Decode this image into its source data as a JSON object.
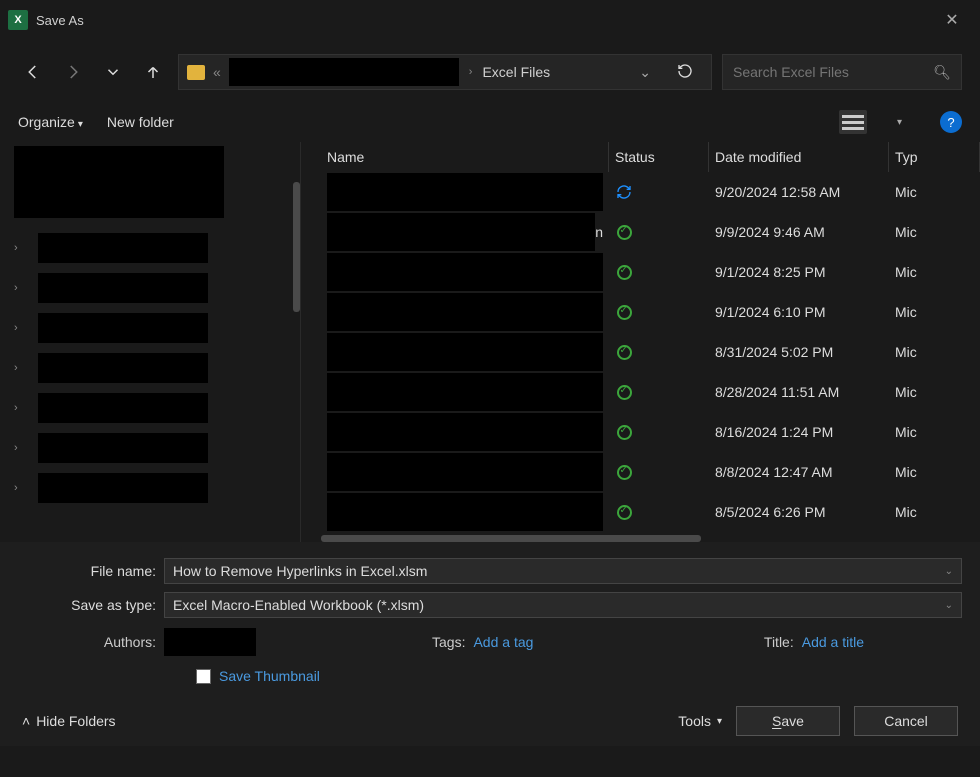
{
  "title": "Save As",
  "breadcrumb": {
    "segment": "Excel Files"
  },
  "search": {
    "placeholder": "Search Excel Files"
  },
  "toolbar": {
    "organize": "Organize",
    "new_folder": "New folder"
  },
  "columns": {
    "name": "Name",
    "status": "Status",
    "date": "Date modified",
    "type": "Typ"
  },
  "rows": [
    {
      "status": "sync",
      "date": "9/20/2024 12:58 AM",
      "type": "Mic",
      "name_tail": ""
    },
    {
      "status": "ok",
      "date": "9/9/2024 9:46 AM",
      "type": "Mic",
      "name_tail": "n"
    },
    {
      "status": "ok",
      "date": "9/1/2024 8:25 PM",
      "type": "Mic",
      "name_tail": ""
    },
    {
      "status": "ok",
      "date": "9/1/2024 6:10 PM",
      "type": "Mic",
      "name_tail": ""
    },
    {
      "status": "ok",
      "date": "8/31/2024 5:02 PM",
      "type": "Mic",
      "name_tail": ""
    },
    {
      "status": "ok",
      "date": "8/28/2024 11:51 AM",
      "type": "Mic",
      "name_tail": ""
    },
    {
      "status": "ok",
      "date": "8/16/2024 1:24 PM",
      "type": "Mic",
      "name_tail": ""
    },
    {
      "status": "ok",
      "date": "8/8/2024 12:47 AM",
      "type": "Mic",
      "name_tail": ""
    },
    {
      "status": "ok",
      "date": "8/5/2024 6:26 PM",
      "type": "Mic",
      "name_tail": ""
    }
  ],
  "sidebar_count": 7,
  "form": {
    "file_name_label": "File name:",
    "file_name_value": "How to Remove Hyperlinks in Excel.xlsm",
    "type_label": "Save as type:",
    "type_value": "Excel Macro-Enabled Workbook (*.xlsm)",
    "authors_label": "Authors:",
    "tags_label": "Tags:",
    "tags_placeholder": "Add a tag",
    "title_label": "Title:",
    "title_placeholder": "Add a title",
    "thumb_label": "Save Thumbnail"
  },
  "footer": {
    "hide_folders": "Hide Folders",
    "tools": "Tools",
    "save": "Save",
    "cancel": "Cancel"
  }
}
